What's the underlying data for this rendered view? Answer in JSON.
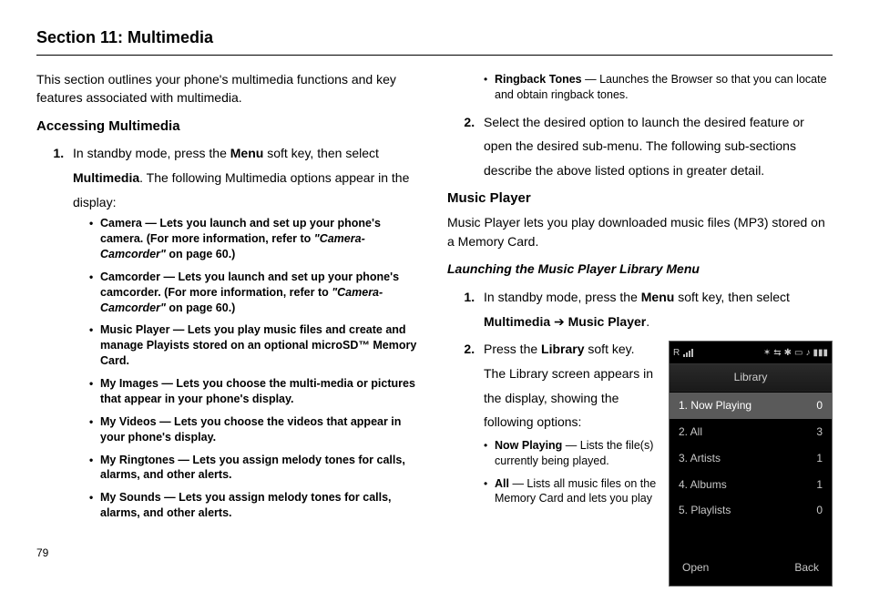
{
  "header": {
    "title": "Section 11: Multimedia"
  },
  "page_number": "79",
  "left": {
    "intro": "This section outlines your phone's multimedia functions and key features associated with multimedia.",
    "h2": "Accessing Multimedia",
    "step1_pre": "In standby mode, press the ",
    "step1_menu": "Menu",
    "step1_mid": " soft key, then select ",
    "step1_mm": "Multimedia",
    "step1_post": ". The following Multimedia options appear in the display:",
    "bullets": [
      {
        "name": "Camera",
        "text": " — Lets you launch and set up your phone's camera. (For more information, refer to ",
        "ref": "\"Camera-Camcorder\"",
        "tail": "  on page 60.)"
      },
      {
        "name": "Camcorder",
        "text": " — Lets you launch and set up your phone's camcorder. (For more information, refer to ",
        "ref": "\"Camera-Camcorder\"",
        "tail": "  on page 60.)"
      },
      {
        "name": "Music Player",
        "text": " — Lets you play music files and create and manage Playists stored on an optional microSD™ Memory Card.",
        "ref": "",
        "tail": ""
      },
      {
        "name": "My Images",
        "text": " — Lets you choose the multi-media or pictures that appear in your phone's display.",
        "ref": "",
        "tail": ""
      },
      {
        "name": "My Videos",
        "text": " — Lets you choose the videos that appear in your phone's display.",
        "ref": "",
        "tail": ""
      },
      {
        "name": "My Ringtones",
        "text": " — Lets you assign melody tones for calls, alarms, and other alerts.",
        "ref": "",
        "tail": ""
      },
      {
        "name": "My Sounds",
        "text": " — Lets you assign melody tones for calls, alarms, and other alerts.",
        "ref": "",
        "tail": ""
      }
    ]
  },
  "right": {
    "top_bullet_name": "Ringback Tones",
    "top_bullet_text": " —  Launches the Browser so that you can locate and obtain ringback tones.",
    "step2_text": "Select the desired option to launch the desired feature or open the desired sub-menu. The following sub-sections describe the above listed options in greater detail.",
    "h2": "Music Player",
    "mp_intro": "Music Player lets you play downloaded music files (MP3) stored on a Memory Card.",
    "h3": "Launching the Music Player Library Menu",
    "mp_step1_pre": "In standby mode, press the ",
    "mp_step1_menu": "Menu",
    "mp_step1_mid": " soft key, then select ",
    "mp_step1_path1": "Multimedia",
    "mp_step1_arrow": " ➔ ",
    "mp_step1_path2": "Music Player",
    "mp_step1_post": ".",
    "mp_step2_pre": "Press the ",
    "mp_step2_lib": "Library",
    "mp_step2_post": " soft key. The Library screen appears in the display, showing the following options:",
    "mp_bullets": [
      {
        "name": "Now Playing",
        "text": " — Lists the file(s) currently being played."
      },
      {
        "name": "All",
        "text": " — Lists all music files on the Memory Card and lets you play"
      }
    ]
  },
  "phone": {
    "status_left": "R",
    "title": "Library",
    "items": [
      {
        "label": "1. Now Playing",
        "value": "0",
        "selected": true
      },
      {
        "label": "2. All",
        "value": "3",
        "selected": false
      },
      {
        "label": "3. Artists",
        "value": "1",
        "selected": false
      },
      {
        "label": "4. Albums",
        "value": "1",
        "selected": false
      },
      {
        "label": "5. Playlists",
        "value": "0",
        "selected": false
      }
    ],
    "soft_left": "Open",
    "soft_right": "Back"
  }
}
